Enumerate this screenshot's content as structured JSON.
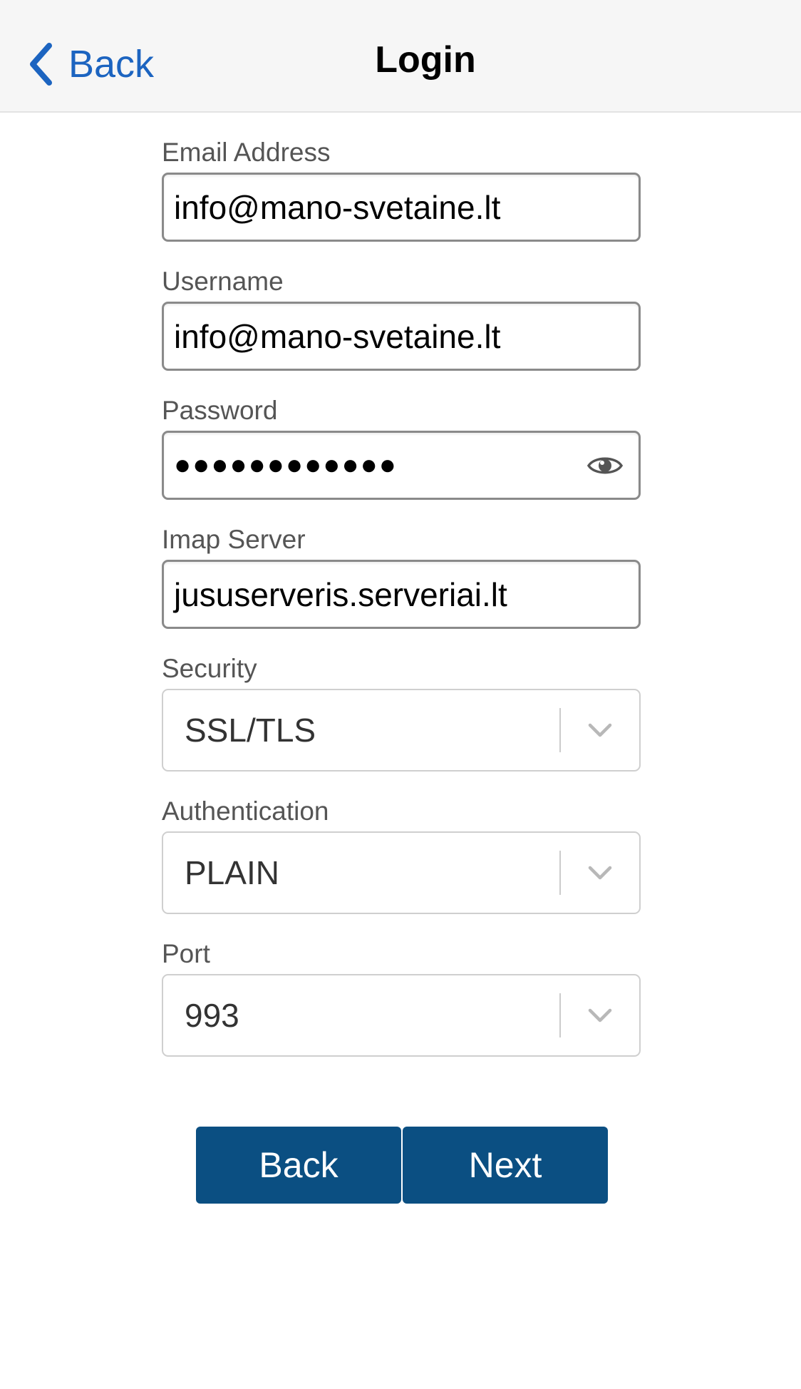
{
  "nav": {
    "back_label": "Back",
    "title": "Login"
  },
  "form": {
    "email": {
      "label": "Email Address",
      "value": "info@mano-svetaine.lt"
    },
    "username": {
      "label": "Username",
      "value": "info@mano-svetaine.lt"
    },
    "password": {
      "label": "Password",
      "masked_value": "●●●●●●●●●●●●"
    },
    "imap_server": {
      "label": "Imap Server",
      "value": "jususerveris.serveriai.lt"
    },
    "security": {
      "label": "Security",
      "selected": "SSL/TLS"
    },
    "authentication": {
      "label": "Authentication",
      "selected": "PLAIN"
    },
    "port": {
      "label": "Port",
      "selected": "993"
    }
  },
  "buttons": {
    "back_label": "Back",
    "next_label": "Next"
  },
  "colors": {
    "accent": "#1c64c0",
    "button_bg": "#0b4f82",
    "navbar_bg": "#f6f6f6"
  },
  "icons": {
    "nav_back": "chevron-left-icon",
    "password_toggle": "eye-icon",
    "select_arrow": "chevron-down-icon"
  }
}
